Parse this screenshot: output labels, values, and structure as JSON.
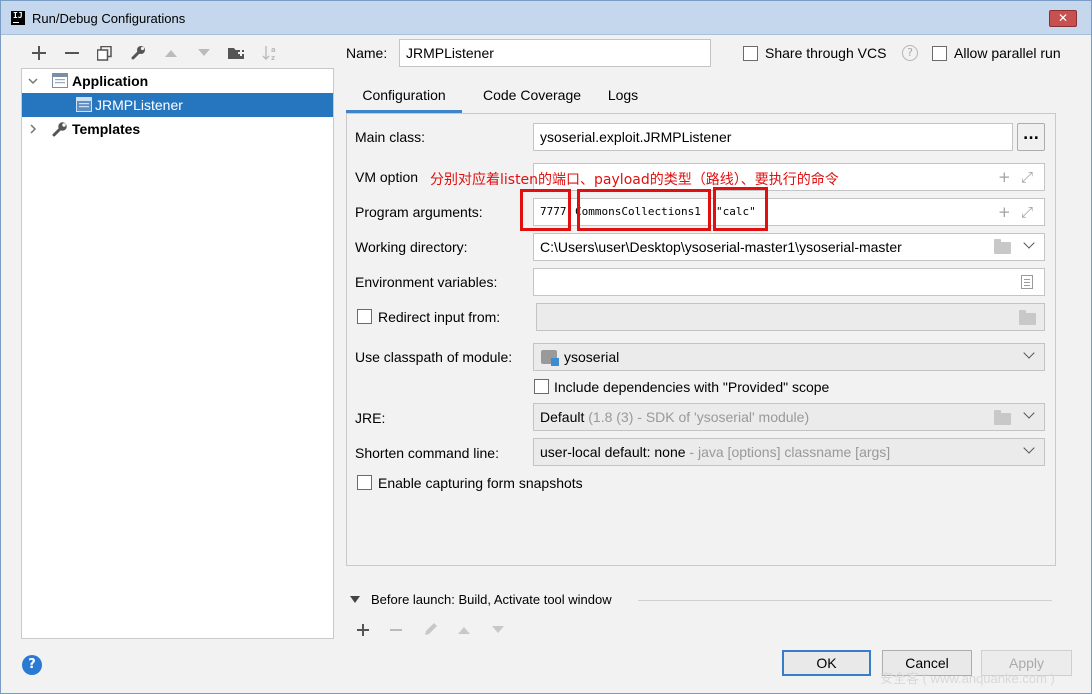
{
  "window": {
    "title": "Run/Debug Configurations",
    "close_glyph": "✕"
  },
  "toolbar": {
    "items": [
      "plus-icon",
      "minus-icon",
      "copy-icon",
      "wrench-icon",
      "arrow-up-icon",
      "arrow-down-icon",
      "folder-add-icon",
      "sort-az-icon"
    ]
  },
  "tree": {
    "application": "Application",
    "listener": "JRMPListener",
    "templates": "Templates"
  },
  "header": {
    "name_label": "Name:",
    "name_value": "JRMPListener",
    "share_vcs": "Share through VCS",
    "allow_parallel": "Allow parallel run"
  },
  "tabs": [
    "Configuration",
    "Code Coverage",
    "Logs"
  ],
  "form": {
    "main_class_label": "Main class:",
    "main_class_value": "ysoserial.exploit.JRMPListener",
    "ellipsis": "...",
    "vm_options_label": "VM option",
    "program_args_label": "Program arguments:",
    "arg_port": "7777",
    "arg_payload": "CommonsCollections1",
    "arg_cmd": "\"calc\"",
    "working_dir_label": "Working directory:",
    "working_dir_value": "C:\\Users\\user\\Desktop\\ysoserial-master1\\ysoserial-master",
    "env_vars_label": "Environment variables:",
    "redirect_label": "Redirect input from:",
    "classpath_label": "Use classpath of module:",
    "classpath_value": "ysoserial",
    "include_deps": "Include dependencies with \"Provided\" scope",
    "jre_label": "JRE:",
    "jre_default": "Default",
    "jre_detail": " (1.8 (3) - SDK of 'ysoserial' module)",
    "shorten_label": "Shorten command line:",
    "shorten_value": "user-local default: none",
    "shorten_detail": " - java [options] classname [args]",
    "snapshots_label": "Enable capturing form snapshots"
  },
  "annotation": "分别对应着listen的端口、payload的类型（路线）、要执行的命令",
  "before_launch": "Before launch: Build, Activate tool window",
  "buttons": {
    "ok": "OK",
    "cancel": "Cancel",
    "apply": "Apply",
    "help": "?"
  },
  "watermark": "安全客 ( www.anquanke.com )",
  "colors": {
    "selection": "#2675bf",
    "annotation_red": "#e01010",
    "tab_underline": "#4083c9"
  }
}
